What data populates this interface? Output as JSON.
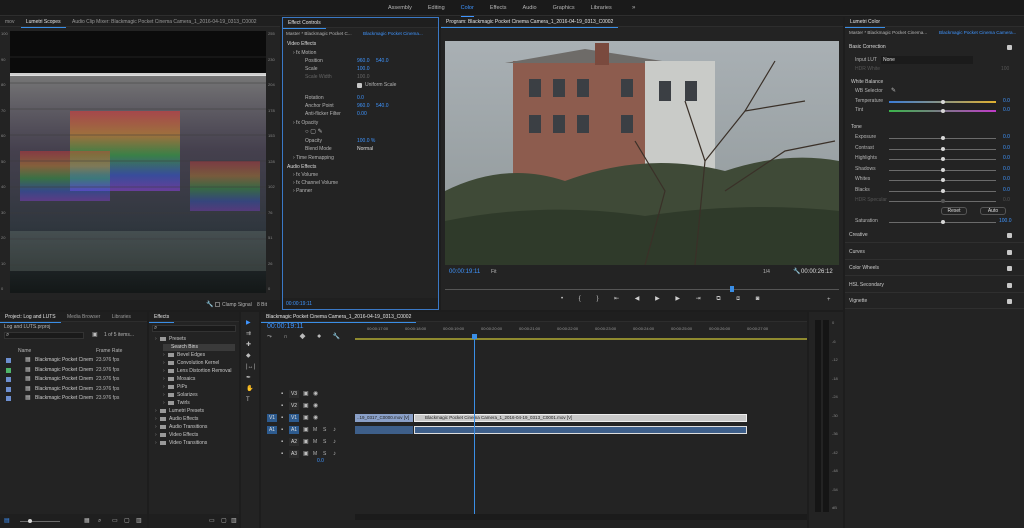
{
  "workspace_tabs": [
    "Assembly",
    "Editing",
    "Color",
    "Effects",
    "Audio",
    "Graphics",
    "Libraries"
  ],
  "workspace_active": "Color",
  "workspace_more": "»",
  "scopes": {
    "tab_left": "mov",
    "tab_scopes": "Lumetri Scopes",
    "tab_audio": "Audio Clip Mixer: Blackmagic Pocket Cinema Camera_1_2016-04-19_0313_C0002",
    "left_ticks": [
      "100",
      "90",
      "80",
      "70",
      "60",
      "50",
      "40",
      "30",
      "20",
      "10",
      "0"
    ],
    "right_ticks": [
      "255",
      "230",
      "204",
      "178",
      "153",
      "128",
      "102",
      "76",
      "51",
      "26",
      "0"
    ],
    "clamp_label": "Clamp Signal",
    "bit_label": "8 Bit"
  },
  "effect_controls": {
    "tab": "Effect Controls",
    "master": "Master * Blackmagic Pocket C...",
    "clip": "Blackmagic Pocket Cinema...",
    "video_effects": "Video Effects",
    "motion": "Motion",
    "position_label": "Position",
    "position_x": "960.0",
    "position_y": "540.0",
    "scale_label": "Scale",
    "scale_val": "100.0",
    "scale_width_label": "Scale Width",
    "scale_width_val": "100.0",
    "uniform_scale": "Uniform Scale",
    "rotation_label": "Rotation",
    "rotation_val": "0.0",
    "anchor_label": "Anchor Point",
    "anchor_x": "960.0",
    "anchor_y": "540.0",
    "antiflicker_label": "Anti-flicker Filter",
    "antiflicker_val": "0.00",
    "opacity": "Opacity",
    "opacity_label": "Opacity",
    "opacity_val": "100.0 %",
    "blend_label": "Blend Mode",
    "blend_val": "Normal",
    "time_remap": "Time Remapping",
    "audio_effects": "Audio Effects",
    "volume": "Volume",
    "channel_volume": "Channel Volume",
    "panner": "Panner",
    "timecode": "00:00:19:11"
  },
  "program": {
    "title": "Program: Blackmagic Pocket Cinema Camera_1_2016-04-19_0313_C0002",
    "timecode": "00:00:19:11",
    "fit": "Fit",
    "quality": "1/4",
    "duration": "00:00:26:12"
  },
  "lumetri": {
    "title": "Lumetri Color",
    "master": "Master * Blackmagic Pocket Cinema...",
    "clip": "Blackmagic Pocket Cinema Camera...",
    "basic": "Basic Correction",
    "input_lut_label": "Input LUT",
    "input_lut_val": "None",
    "hdr_white_label": "HDR White",
    "hdr_white_val": "100",
    "wb": "White Balance",
    "wb_selector": "WB Selector",
    "temperature_label": "Temperature",
    "temperature_val": "0.0",
    "tint_label": "Tint",
    "tint_val": "0.0",
    "tone": "Tone",
    "tone_rows": [
      {
        "label": "Exposure",
        "value": "0.0"
      },
      {
        "label": "Contrast",
        "value": "0.0"
      },
      {
        "label": "Highlights",
        "value": "0.0"
      },
      {
        "label": "Shadows",
        "value": "0.0"
      },
      {
        "label": "Whites",
        "value": "0.0"
      },
      {
        "label": "Blacks",
        "value": "0.0"
      },
      {
        "label": "HDR Specular",
        "value": "0.0"
      }
    ],
    "reset": "Reset",
    "auto": "Auto",
    "saturation_label": "Saturation",
    "saturation_val": "100.0",
    "sections": [
      "Creative",
      "Curves",
      "Color Wheels",
      "HSL Secondary",
      "Vignette"
    ]
  },
  "project": {
    "tab": "Project: Log and LUTS",
    "tab2": "Media Browser",
    "tab3": "Libraries",
    "file": "Log and LUTS.prproj",
    "items_count": "1 of 5 items...",
    "col_name": "Name",
    "col_rate": "Frame Rate",
    "rows": [
      {
        "name": "Blackmagic Pocket Cinem",
        "rate": "23.976 fps",
        "swatch": "#6d8fd0"
      },
      {
        "name": "Blackmagic Pocket Cinem",
        "rate": "23.976 fps",
        "swatch": "#4fb56a"
      },
      {
        "name": "Blackmagic Pocket Cinem",
        "rate": "23.976 fps",
        "swatch": "#6d8fd0"
      },
      {
        "name": "Blackmagic Pocket Cinem",
        "rate": "23.976 fps",
        "swatch": "#6d8fd0"
      },
      {
        "name": "Blackmagic Pocket Cinem",
        "rate": "23.976 fps",
        "swatch": "#6d8fd0"
      }
    ]
  },
  "effects": {
    "tab": "Effects",
    "tree": [
      {
        "label": "Presets",
        "indent": 0
      },
      {
        "label": "Bevel Edges",
        "indent": 1
      },
      {
        "label": "Convolution Kernel",
        "indent": 1
      },
      {
        "label": "Lens Distortion Removal",
        "indent": 1
      },
      {
        "label": "Mosaics",
        "indent": 1
      },
      {
        "label": "PiPs",
        "indent": 1
      },
      {
        "label": "Solarizes",
        "indent": 1
      },
      {
        "label": "Twirls",
        "indent": 1
      },
      {
        "label": "Lumetri Presets",
        "indent": 0
      },
      {
        "label": "Audio Effects",
        "indent": 0
      },
      {
        "label": "Audio Transitions",
        "indent": 0
      },
      {
        "label": "Video Effects",
        "indent": 0
      },
      {
        "label": "Video Transitions",
        "indent": 0
      }
    ],
    "selected": "Search Bins"
  },
  "timeline": {
    "title": "Blackmagic Pocket Cinema Camera_1_2016-04-19_0313_C0002",
    "timecode": "00:00:19:11",
    "ruler": [
      "00:00:17:00",
      "00:00:18:00",
      "00:00:19:00",
      "00:00:20:00",
      "00:00:21:00",
      "00:00:22:00",
      "00:00:23:00",
      "00:00:24:00",
      "00:00:25:00",
      "00:00:26:00",
      "00:00:27:00"
    ],
    "tracks": [
      "V3",
      "V2",
      "V1",
      "A1",
      "A2",
      "A3"
    ],
    "src_v": "V1",
    "src_a": "A1",
    "clip_left": "..19_0317_C0000.mov [V]",
    "clip_main": "Blackmagic Pocket Cinema Camera_1_2016-04-19_0313_C0001.mov [V]",
    "volume": "0.0"
  },
  "meter_ticks": [
    "0",
    "-6",
    "-12",
    "-18",
    "-24",
    "-30",
    "-36",
    "-42",
    "-48",
    "-54",
    "dB"
  ]
}
